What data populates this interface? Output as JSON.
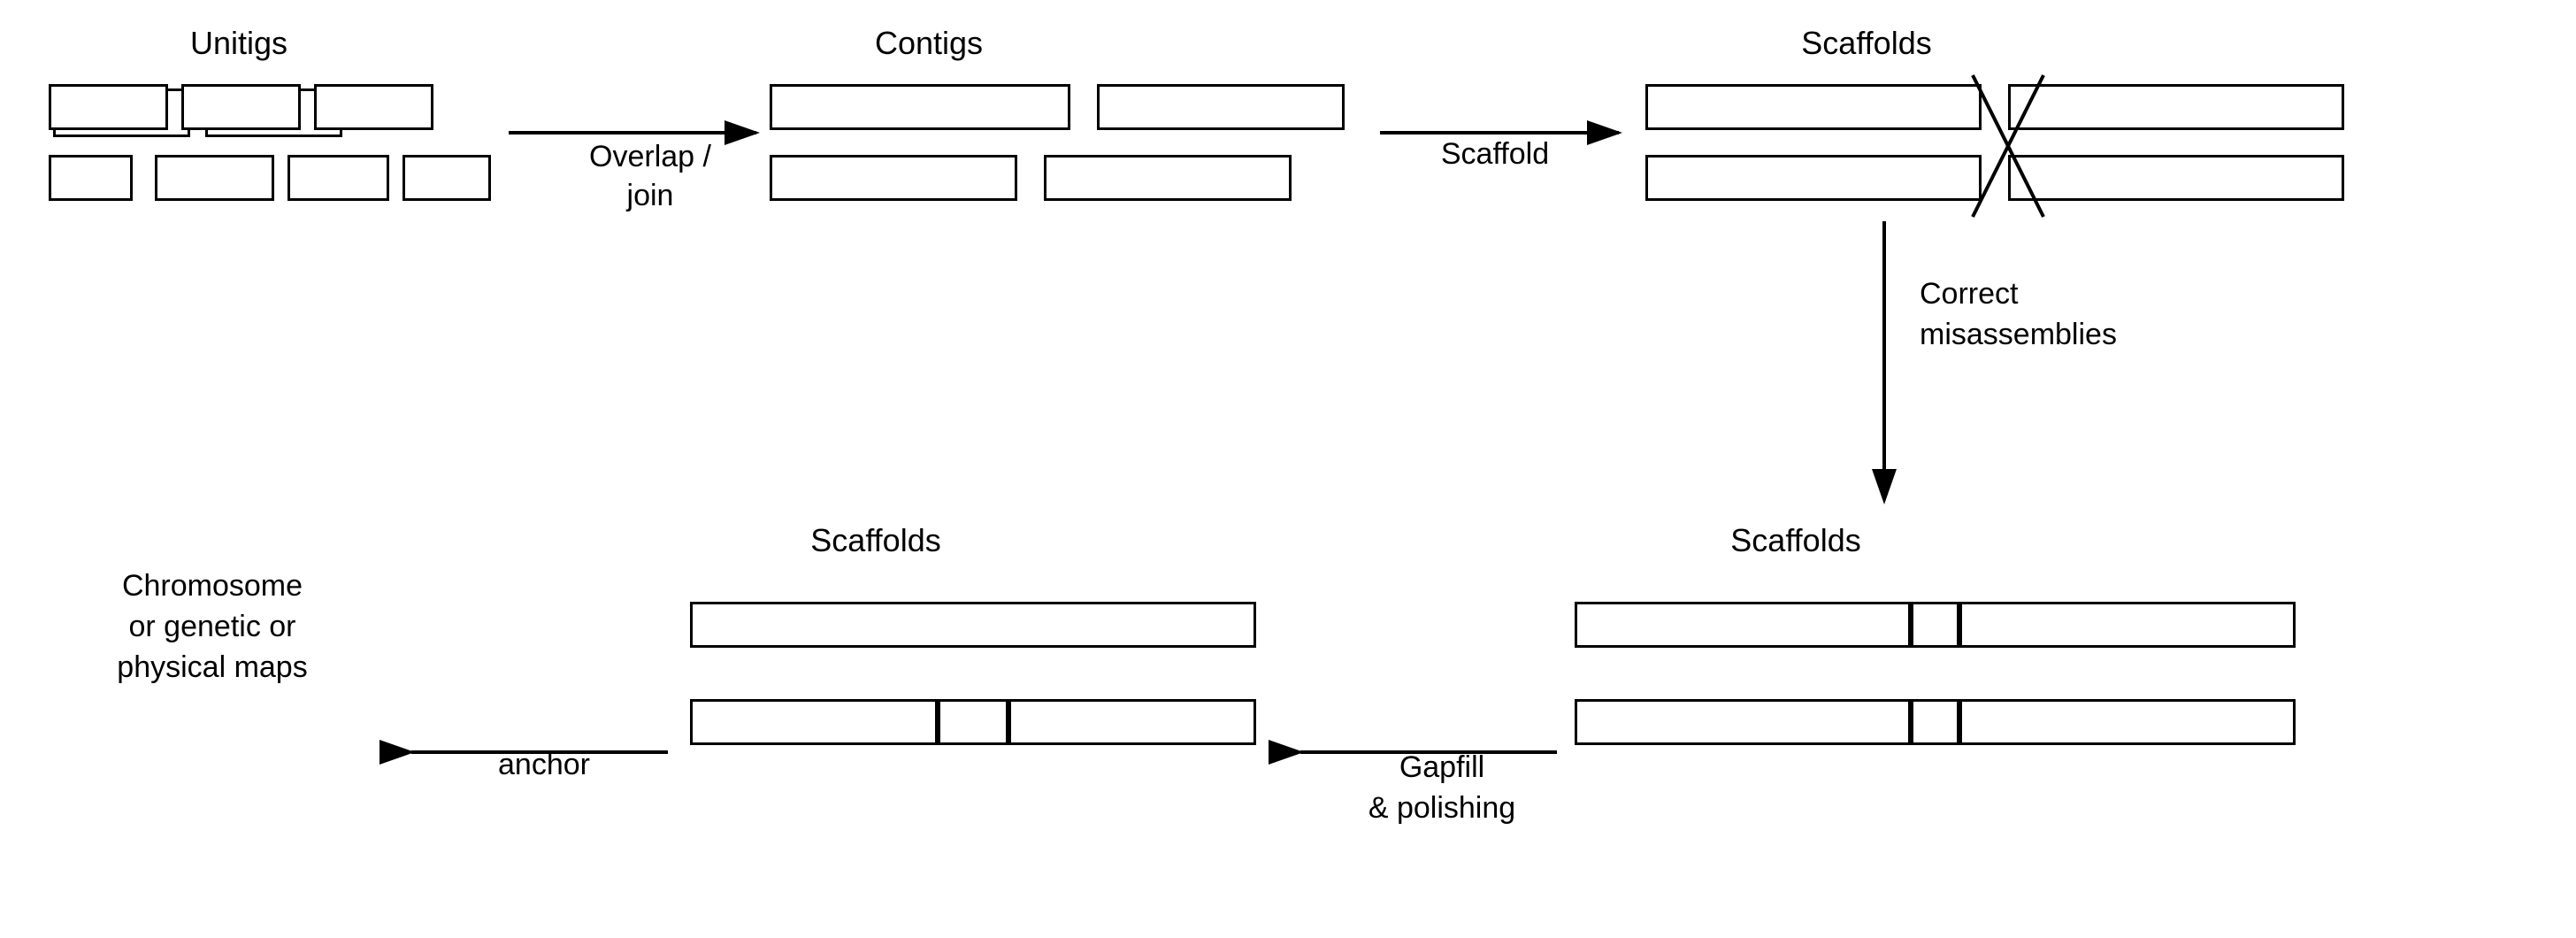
{
  "labels": {
    "unitigs": "Unitigs",
    "contigs": "Contigs",
    "scaffolds_top": "Scaffolds",
    "overlap_join": "Overlap /\njoin",
    "scaffold": "Scaffold",
    "correct_misassemblies": "Correct\nmisassemblies",
    "scaffolds_bottom_left": "Scaffolds",
    "scaffolds_bottom_right": "Scaffolds",
    "chromosome": "Chromosome\nor genetic or\nphysical maps",
    "anchor": "anchor",
    "gapfill": "Gapfill\n& polishing"
  },
  "colors": {
    "line": "#000000",
    "bg": "#ffffff"
  }
}
